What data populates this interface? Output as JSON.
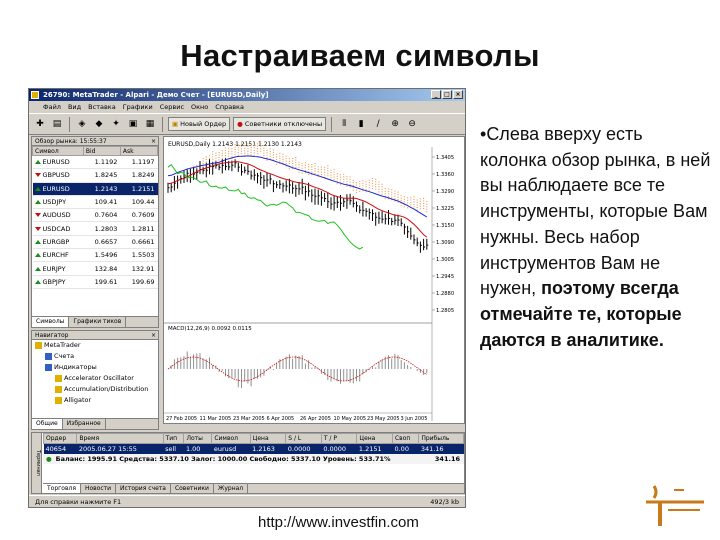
{
  "slide": {
    "title": "Настраиваем символы",
    "bullet_marker": "•",
    "bullet_normal": "Слева вверху есть колонка обзор рынка, в ней вы наблюдаете все те инструменты, которые Вам нужны. Весь набор инструментов Вам не нужен, ",
    "bullet_bold": "поэтому всегда отмечайте те, которые даются в аналитике.",
    "url": "http://www.investfin.com"
  },
  "window": {
    "title": "26790: MetaTrader - Alpari - Демо Счет - [EURUSD,Daily]",
    "menu": [
      "Файл",
      "Вид",
      "Вставка",
      "Графики",
      "Сервис",
      "Окно",
      "Справка"
    ],
    "toolbar": {
      "new_order": "Новый Ордер",
      "expert_advisors": "Советники отключены"
    }
  },
  "market_watch": {
    "header": "Обзор рынка: 15:55:37",
    "columns": [
      "Символ",
      "Bid",
      "Ask"
    ],
    "rows": [
      {
        "symbol": "EURUSD",
        "bid": "1.1192",
        "ask": "1.1197",
        "dir": "up"
      },
      {
        "symbol": "GBPUSD",
        "bid": "1.8245",
        "ask": "1.8249",
        "dir": "down"
      },
      {
        "symbol": "EURUSD",
        "bid": "1.2143",
        "ask": "1.2151",
        "dir": "up",
        "selected": true
      },
      {
        "symbol": "USDJPY",
        "bid": "109.41",
        "ask": "109.44",
        "dir": "up"
      },
      {
        "symbol": "AUDUSD",
        "bid": "0.7604",
        "ask": "0.7609",
        "dir": "down"
      },
      {
        "symbol": "USDCAD",
        "bid": "1.2803",
        "ask": "1.2811",
        "dir": "down"
      },
      {
        "symbol": "EURGBP",
        "bid": "0.6657",
        "ask": "0.6661",
        "dir": "up"
      },
      {
        "symbol": "EURCHF",
        "bid": "1.5496",
        "ask": "1.5503",
        "dir": "up"
      },
      {
        "symbol": "EURJPY",
        "bid": "132.84",
        "ask": "132.91",
        "dir": "up"
      },
      {
        "symbol": "GBPJPY",
        "bid": "199.61",
        "ask": "199.69",
        "dir": "up"
      }
    ],
    "tabs": [
      "Символы",
      "Графики тиков"
    ]
  },
  "navigator": {
    "header": "Навигатор",
    "items": [
      {
        "label": "MetaTrader",
        "level": 0,
        "color": "#e0b000"
      },
      {
        "label": "Счета",
        "level": 1,
        "color": "#3060c0"
      },
      {
        "label": "Индикаторы",
        "level": 1,
        "color": "#3060c0"
      },
      {
        "label": "Accelerator Oscillator",
        "level": 2,
        "color": "#e0b000"
      },
      {
        "label": "Accumulation/Distribution",
        "level": 2,
        "color": "#e0b000"
      },
      {
        "label": "Alligator",
        "level": 2,
        "color": "#e0b000"
      }
    ],
    "tabs": [
      "Общие",
      "Избранное"
    ]
  },
  "chart": {
    "header": "EURUSD,Daily  1.2143 1.2151 1.2130 1.2143",
    "price_labels": [
      "1.3405",
      "1.3360",
      "1.3290",
      "1.3225",
      "1.3150",
      "1.3090",
      "1.3005",
      "1.2945",
      "1.2880",
      "1.2805"
    ],
    "date_labels": [
      "27 Feb 2005",
      "11 Mar 2005",
      "23 Mar 2005",
      "6 Apr 2005",
      "26 Apr 2005",
      "10 May 2005",
      "23 May 2005",
      "3 Jun 2005"
    ],
    "indicator_label": "MACD(12,26,9) 0.0092 0.0115",
    "colors": {
      "price": "#000000",
      "ma_fast": "#d01010",
      "ma_slow": "#1a2ad0",
      "lagging": "#20c020",
      "cloud": "#e8a060",
      "histogram": "#909090",
      "signal": "#d01010"
    }
  },
  "terminal": {
    "side_label": "Терминал",
    "columns": [
      "Ордер",
      "Время",
      "Тип",
      "Лоты",
      "Символ",
      "Цена",
      "S / L",
      "T / P",
      "Цена",
      "Своп",
      "Прибыль"
    ],
    "row": [
      "40654",
      "2005.06.27 15:55",
      "sell",
      "1.00",
      "eurusd",
      "1.2163",
      "0.0000",
      "0.0000",
      "1.2151",
      "0.00",
      "341.16"
    ],
    "balance": "Баланс: 1995.91  Средства: 5337.10  Залог: 1000.00  Свободно: 5337.10  Уровень: 533.71%",
    "balance_total": "341.16",
    "tabs": [
      "Торговля",
      "Новости",
      "История счета",
      "Советники",
      "Журнал"
    ]
  },
  "status": {
    "left": "Для справки нажмите F1",
    "right": "492/3 kb"
  }
}
